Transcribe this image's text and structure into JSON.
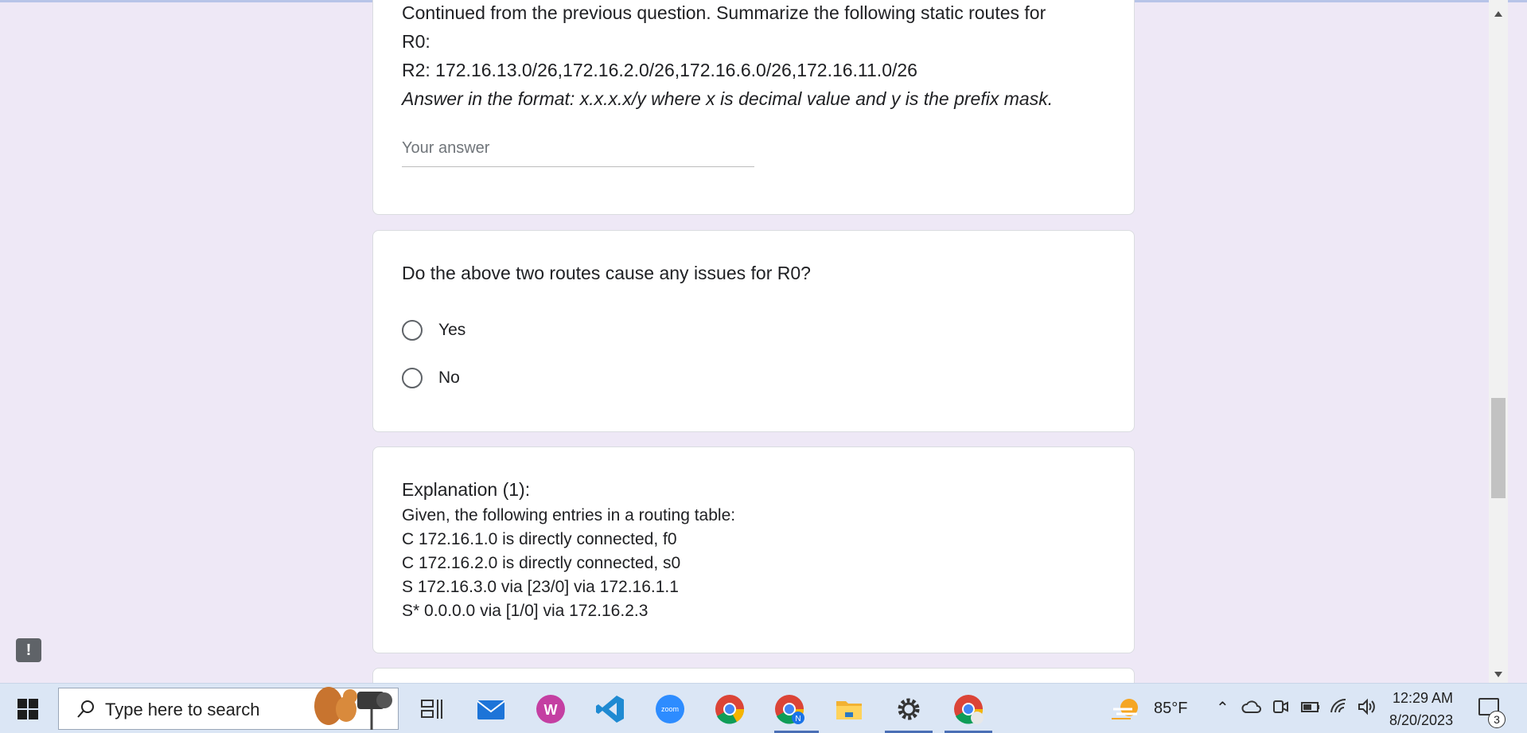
{
  "question1": {
    "line1": "Continued from the previous question. Summarize the following static routes for",
    "line2": "R0:",
    "line3": "R2: 172.16.13.0/26,172.16.2.0/26,172.16.6.0/26,172.16.11.0/26",
    "format_hint": "Answer in the format: x.x.x.x/y where x is decimal value and y is the prefix mask.",
    "answer_placeholder": "Your answer"
  },
  "question2": {
    "text": "Do the above two routes cause any issues for R0?",
    "options": [
      {
        "label": "Yes"
      },
      {
        "label": "No"
      }
    ]
  },
  "explanation": {
    "title": "Explanation (1):",
    "lines": [
      "Given, the following entries in a routing table:",
      "C 172.16.1.0 is directly connected, f0",
      "C 172.16.2.0 is directly connected, s0",
      "S 172.16.3.0 via [23/0] via 172.16.1.1",
      "S* 0.0.0.0 via [1/0] via 172.16.2.3"
    ]
  },
  "feedback_icon": "!",
  "taskbar": {
    "search_placeholder": "Type here to search",
    "apps": [
      "task-view-icon",
      "mail-icon",
      "wps-office-icon",
      "vscode-icon",
      "zoom-icon",
      "chrome-icon",
      "chrome-profile-icon",
      "file-explorer-icon",
      "settings-icon",
      "chrome-canary-icon"
    ],
    "zoom_label": "zoom",
    "chrome_badge": "N",
    "temperature": "85°F",
    "time": "12:29 AM",
    "date": "8/20/2023",
    "notification_count": "3"
  },
  "colors": {
    "page_background": "#eee8f6",
    "card_background": "#ffffff",
    "taskbar_background": "#dbe6f5"
  }
}
